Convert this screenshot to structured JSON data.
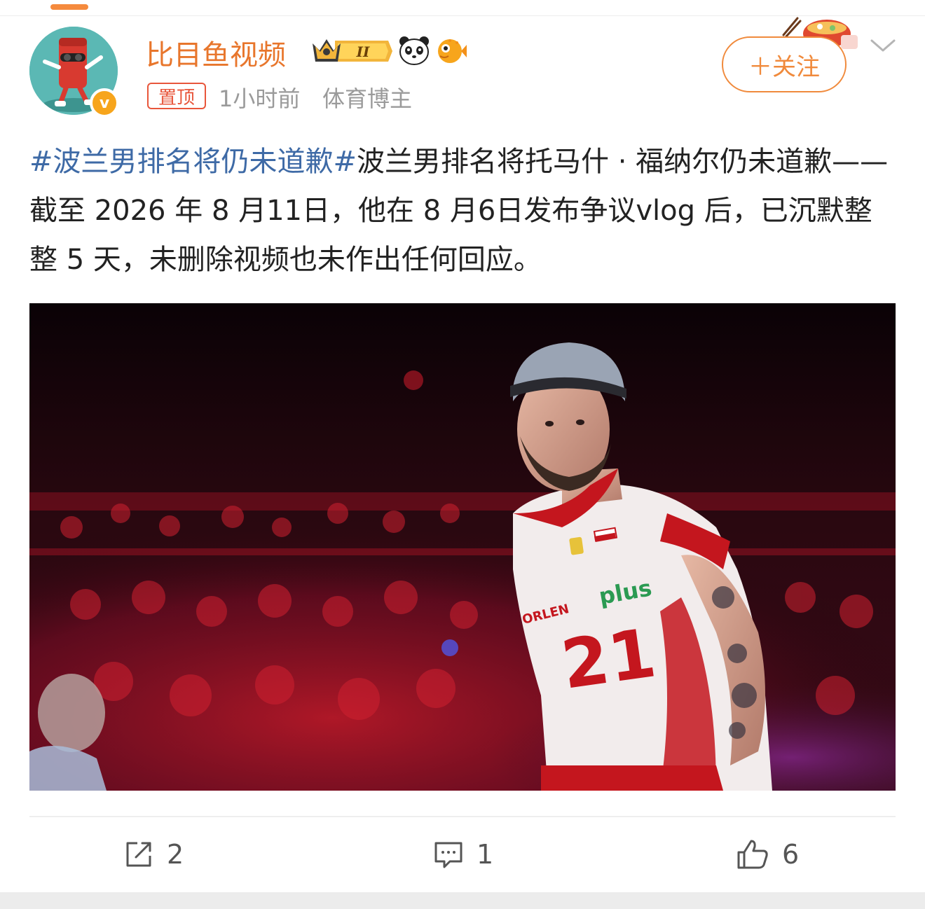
{
  "post": {
    "author": {
      "name": "比目鱼视频",
      "verified_mark": "v",
      "level_badge": "II",
      "icons": [
        "crown-badge-icon",
        "panda-icon",
        "pufferfish-icon"
      ]
    },
    "pin_label": "置顶",
    "time": "1小时前",
    "author_tag": "体育博主",
    "follow_label": "＋关注",
    "text": {
      "hashtag": "#波兰男排名将仍未道歉#",
      "body": "波兰男排名将托马什 · 福纳尔仍未道歉——截至 2026 年 8 月11日，他在 8 月6日发布争议vlog 后，已沉默整整 5 天，未删除视频也未作出任何回应。"
    },
    "image": {
      "jersey_text": "plus",
      "jersey_number": "21",
      "sponsor_text": "ORLEN"
    },
    "actions": {
      "repost": "2",
      "comment": "1",
      "like": "6"
    }
  },
  "colors": {
    "accent": "#f08a3c",
    "username": "#e8762c",
    "hashtag": "#3e6aa6",
    "pin": "#e8563b",
    "meta": "#9a9a9a"
  }
}
